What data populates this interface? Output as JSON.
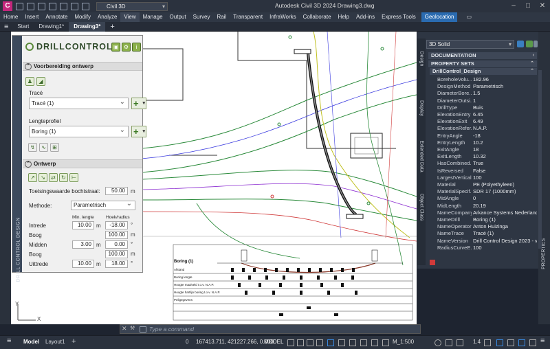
{
  "titlebar": {
    "app_letter": "C",
    "workspace": "Civil 3D",
    "title": "Autodesk Civil 3D 2024   Drawing3.dwg"
  },
  "ribbon_tabs": [
    "Home",
    "Insert",
    "Annotate",
    "Modify",
    "Analyze",
    "View",
    "Manage",
    "Output",
    "Survey",
    "Rail",
    "Transparent",
    "InfraWorks",
    "Collaborate",
    "Help",
    "Add-ins",
    "Express Tools",
    "Geolocation"
  ],
  "doc_tabs": {
    "start": "Start",
    "tabs": [
      "Drawing1*",
      "Drawing3*"
    ]
  },
  "drill": {
    "side_title": "DRILL CONTROL DESIGN",
    "logo": "DRILLCONTROL",
    "section1": "Voorbereiding ontwerp",
    "trace_label": "Tracé",
    "trace_value": "Tracé (1)",
    "profile_label": "Lengteprofiel",
    "profile_value": "Boring (1)",
    "section2": "Ontwerp",
    "check_label": "Toetsingswaarde bochtstraal:",
    "check_value": "50.00",
    "check_unit": "m",
    "method_label": "Methode:",
    "method_value": "Parametrisch",
    "col_min": "Min. lengte",
    "col_angle": "Hoek/radius",
    "rows": [
      {
        "label": "Intrede",
        "len": "10.00",
        "len_unit": "m",
        "val": "-18.00",
        "unit": "°"
      },
      {
        "label": "Boog",
        "len": "",
        "len_unit": "",
        "val": "100.00",
        "unit": "m"
      },
      {
        "label": "Midden",
        "len": "3.00",
        "len_unit": "m",
        "val": "0.00",
        "unit": "°"
      },
      {
        "label": "Boog",
        "len": "",
        "len_unit": "",
        "val": "100.00",
        "unit": "m"
      },
      {
        "label": "Uittrede",
        "len": "10.00",
        "len_unit": "m",
        "val": "18.00",
        "unit": "°"
      }
    ]
  },
  "props": {
    "selector": "3D Solid",
    "vtabs": [
      "Design",
      "Display",
      "Extended Data",
      "Object Class"
    ],
    "right_tab": "PROPERTIES",
    "cat_doc": "DOCUMENTATION",
    "cat_ps": "PROPERTY SETS",
    "cat_dc": "DrillControl_Design",
    "items": [
      [
        "BoreholeVolu...",
        "182.96"
      ],
      [
        "DesignMethod",
        "Parametrisch"
      ],
      [
        "DiameterBore...",
        "1.5"
      ],
      [
        "DiameterOutsi...",
        "1"
      ],
      [
        "DrillType",
        "Buis"
      ],
      [
        "ElevationEntry",
        "6.45"
      ],
      [
        "ElevationExit",
        "6.49"
      ],
      [
        "ElevationRefer...",
        "N.A.P."
      ],
      [
        "EntryAngle",
        "-18"
      ],
      [
        "EntryLength",
        "10.2"
      ],
      [
        "ExitAngle",
        "18"
      ],
      [
        "ExitLength",
        "10.32"
      ],
      [
        "HasCombined...",
        "True"
      ],
      [
        "IsReversed",
        "False"
      ],
      [
        "LargestVertical...",
        "100"
      ],
      [
        "Material",
        "PE (Polyethyleen)"
      ],
      [
        "MaterialSpecif...",
        "SDR 17 (1000mm)"
      ],
      [
        "MidAngle",
        "0"
      ],
      [
        "MidLength",
        "20.19"
      ],
      [
        "NameCompany",
        "Arkance Systems Nederland"
      ],
      [
        "NameDrill",
        "Boring (1)"
      ],
      [
        "NameOperator",
        "Anton Huizinga"
      ],
      [
        "NameTrace",
        "Tracé (1)"
      ],
      [
        "NameVersion",
        "Drill Control Design 2023 - v..."
      ],
      [
        "RadiusCurveE...",
        "100"
      ]
    ]
  },
  "profile_sheet": {
    "title": "Boring (1)",
    "row_labels": [
      "Afstand",
      "Boring lengte",
      "Hoogte maaiveld t.o.v. N.A.P.",
      "Hoogte hartlijn boring t.o.v. N.A.P.",
      "Peilgegevens"
    ]
  },
  "cmdline": {
    "placeholder": "Type a command"
  },
  "status": {
    "model": "Model",
    "layout": "Layout1",
    "coords": "167413.711, 421227.266, 0.000",
    "mode": "MODEL",
    "scale": "M_1:500",
    "lw": "1.4"
  },
  "colors": {
    "accent": "#2a6bb0",
    "app_icon": "#c4267c",
    "panel_bg": "#2e3643"
  }
}
